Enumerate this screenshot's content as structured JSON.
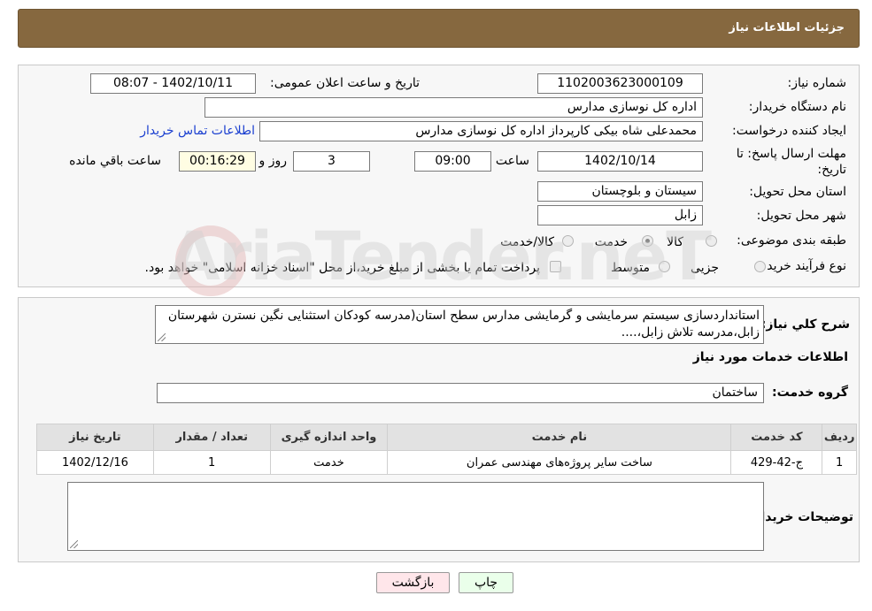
{
  "header": {
    "title": "جزئیات اطلاعات نیاز"
  },
  "form": {
    "need_number": {
      "label": "شماره نیاز:",
      "value": "1102003623000109"
    },
    "announce_datetime": {
      "label": "تاریخ و ساعت اعلان عمومی:",
      "value": "1402/10/11 - 08:07"
    },
    "buyer_org": {
      "label": "نام دستگاه خریدار:",
      "value": "اداره کل نوسازی مدارس"
    },
    "requester": {
      "label": "ایجاد کننده درخواست:",
      "value": "محمدعلی شاه بیکی کارپرداز اداره کل نوسازی مدارس",
      "contact_link": "اطلاعات تماس خریدار"
    },
    "deadline": {
      "label": "مهلت ارسال پاسخ: تا تاریخ:",
      "date": "1402/10/14",
      "time_label": "ساعت",
      "time": "09:00",
      "days": "3",
      "days_label": "روز و",
      "remaining": "00:16:29",
      "remaining_label": "ساعت باقي مانده"
    },
    "province": {
      "label": "استان محل تحویل:",
      "value": "سیستان و بلوچستان"
    },
    "city": {
      "label": "شهر محل تحویل:",
      "value": "زابل"
    },
    "category": {
      "label": "طبقه بندی موضوعی:",
      "options": [
        {
          "label": "کالا",
          "checked": false
        },
        {
          "label": "خدمت",
          "checked": true
        },
        {
          "label": "کالا/خدمت",
          "checked": false
        }
      ]
    },
    "purchase_type": {
      "label": "نوع فرآیند خرید :",
      "options": [
        {
          "label": "جزیی",
          "checked": false
        },
        {
          "label": "متوسط",
          "checked": false
        }
      ],
      "payment_note": "پرداخت تمام یا بخشی از مبلغ خرید،از محل \"اسناد خزانه اسلامی\" خواهد بود."
    }
  },
  "details": {
    "description_label": "شرح کلي نياز:",
    "description": "استانداردسازی سیستم سرمایشی و گرمایشی مدارس سطح استان(مدرسه کودکان استثنایی نگین نسترن شهرستان زابل،مدرسه تلاش زابل،....",
    "services_title": "اطلاعات خدمات مورد نياز",
    "service_group_label": "گروه خدمت:",
    "service_group": "ساختمان",
    "table": {
      "headers": [
        "ردیف",
        "کد خدمت",
        "نام خدمت",
        "واحد اندازه گیری",
        "تعداد / مقدار",
        "تاریخ نیاز"
      ],
      "rows": [
        [
          "1",
          "ج-42-429",
          "ساخت سایر پروژه‌های مهندسی عمران",
          "خدمت",
          "1",
          "1402/12/16"
        ]
      ]
    },
    "buyer_notes_label": "توضیحات خریدار:",
    "buyer_notes": ""
  },
  "buttons": {
    "print": "چاپ",
    "back": "بازگشت"
  },
  "watermark": "AriaTender.neT"
}
